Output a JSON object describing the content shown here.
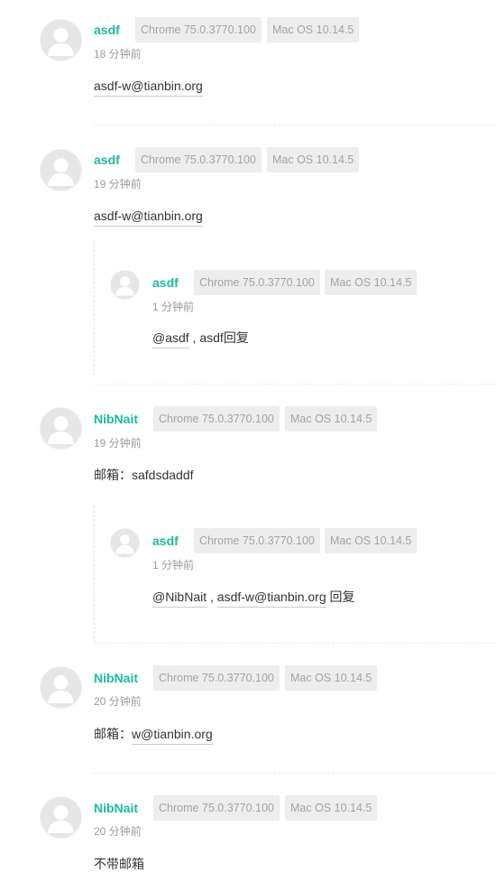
{
  "comments": [
    {
      "nick": "asdf",
      "browser": "Chrome 75.0.3770.100",
      "os": "Mac OS 10.14.5",
      "time": "18 分钟前",
      "link": "asdf-w@tianbin.org"
    },
    {
      "nick": "asdf",
      "browser": "Chrome 75.0.3770.100",
      "os": "Mac OS 10.14.5",
      "time": "19 分钟前",
      "link": "asdf-w@tianbin.org",
      "reply": {
        "nick": "asdf",
        "browser": "Chrome 75.0.3770.100",
        "os": "Mac OS 10.14.5",
        "time": "1 分钟前",
        "mention": "@asdf",
        "sep": " , ",
        "text": "asdf回复"
      }
    },
    {
      "nick": "NibNait",
      "browser": "Chrome 75.0.3770.100",
      "os": "Mac OS 10.14.5",
      "time": "19 分钟前",
      "text": "邮箱：safdsdaddf",
      "reply": {
        "nick": "asdf",
        "browser": "Chrome 75.0.3770.100",
        "os": "Mac OS 10.14.5",
        "time": "1 分钟前",
        "mention": "@NibNait",
        "sep": " , ",
        "link": "asdf-w@tianbin.org",
        "text": " 回复"
      }
    },
    {
      "nick": "NibNait",
      "browser": "Chrome 75.0.3770.100",
      "os": "Mac OS 10.14.5",
      "time": "20 分钟前",
      "prefix": "邮箱：",
      "link": "w@tianbin.org"
    },
    {
      "nick": "NibNait",
      "browser": "Chrome 75.0.3770.100",
      "os": "Mac OS 10.14.5",
      "time": "20 分钟前",
      "text": "不带邮箱"
    }
  ],
  "colors": {
    "nick": "#1abc9c",
    "badge_bg": "#ededed",
    "badge_text": "#a4a4a4",
    "time": "#9c9c9c"
  },
  "icons": {
    "avatar": "default-user-avatar-icon"
  }
}
